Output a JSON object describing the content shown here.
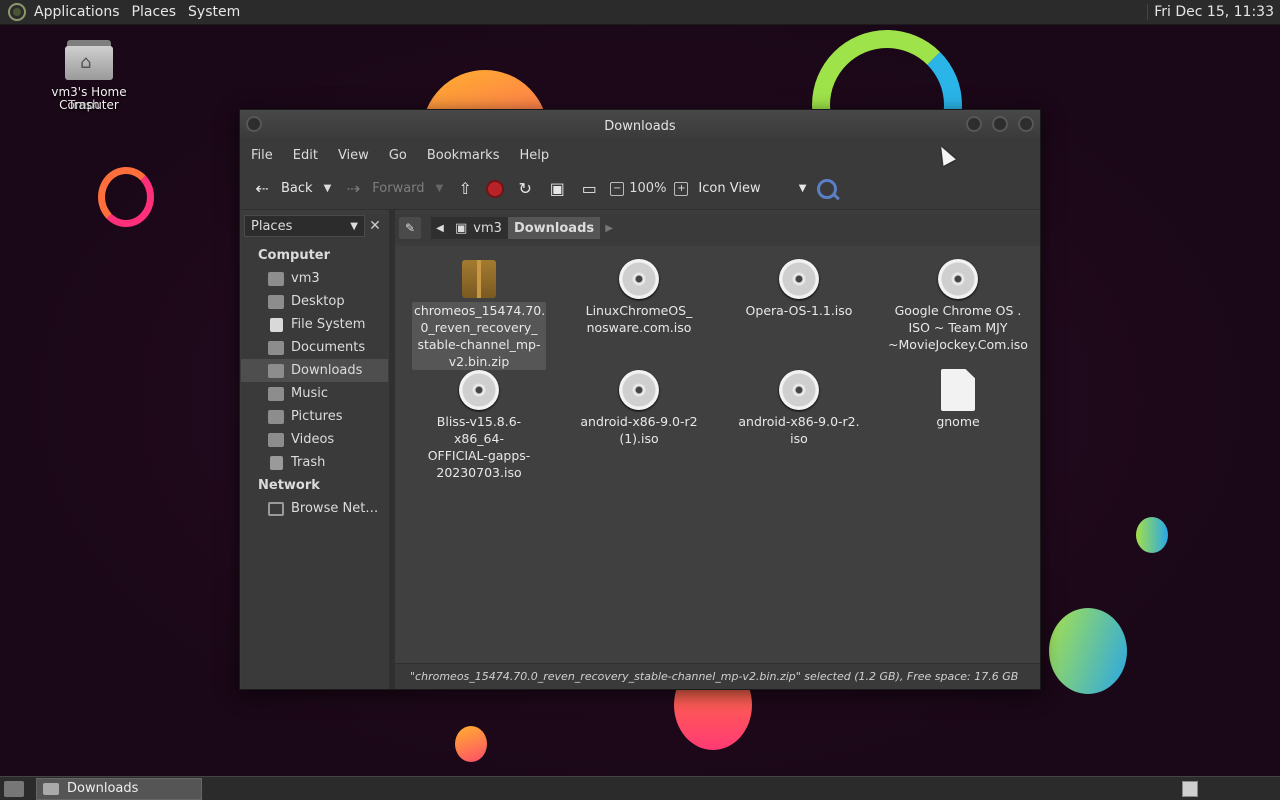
{
  "top_panel": {
    "menus": [
      "Applications",
      "Places",
      "System"
    ],
    "clock": "Fri Dec 15, 11:33"
  },
  "desktop": {
    "icon_label_line1": "vm3's Home",
    "icon_label_line2": "Computer",
    "icon_overlap_label": "Trash"
  },
  "window": {
    "title": "Downloads",
    "menubar": [
      "File",
      "Edit",
      "View",
      "Go",
      "Bookmarks",
      "Help"
    ],
    "toolbar": {
      "back": "Back",
      "forward": "Forward",
      "zoom": "100%",
      "view_mode": "Icon View"
    },
    "sidebar": {
      "selector": "Places",
      "sections": [
        {
          "title": "Computer",
          "items": [
            "vm3",
            "Desktop",
            "File System",
            "Documents",
            "Downloads",
            "Music",
            "Pictures",
            "Videos",
            "Trash"
          ]
        },
        {
          "title": "Network",
          "items": [
            "Browse Net…"
          ]
        }
      ],
      "selected": "Downloads"
    },
    "pathbar": {
      "crumbs": [
        "vm3",
        "Downloads"
      ]
    },
    "files": [
      {
        "name": "chromeos_15474.70.\n0_reven_recovery_\nstable-channel_mp-\nv2.bin.zip",
        "type": "package-icon",
        "selected": true
      },
      {
        "name": "LinuxChromeOS_\nnosware.com.iso",
        "type": "disc-icon"
      },
      {
        "name": "Opera-OS-1.1.iso",
        "type": "disc-icon"
      },
      {
        "name": "Google Chrome OS .\nISO ~ Team MJY\n~MovieJockey.Com.iso",
        "type": "disc-icon"
      },
      {
        "name": "Bliss-v15.8.6-x86_64-\nOFFICIAL-gapps-\n20230703.iso",
        "type": "disc-icon"
      },
      {
        "name": "android-x86-9.0-r2\n(1).iso",
        "type": "disc-icon"
      },
      {
        "name": "android-x86-9.0-r2.\niso",
        "type": "disc-icon"
      },
      {
        "name": "gnome",
        "type": "document-icon"
      }
    ],
    "status": "\"chromeos_15474.70.0_reven_recovery_stable-channel_mp-v2.bin.zip\" selected (1.2 GB), Free space: 17.6 GB"
  },
  "taskbar": {
    "items": [
      "Downloads"
    ]
  }
}
